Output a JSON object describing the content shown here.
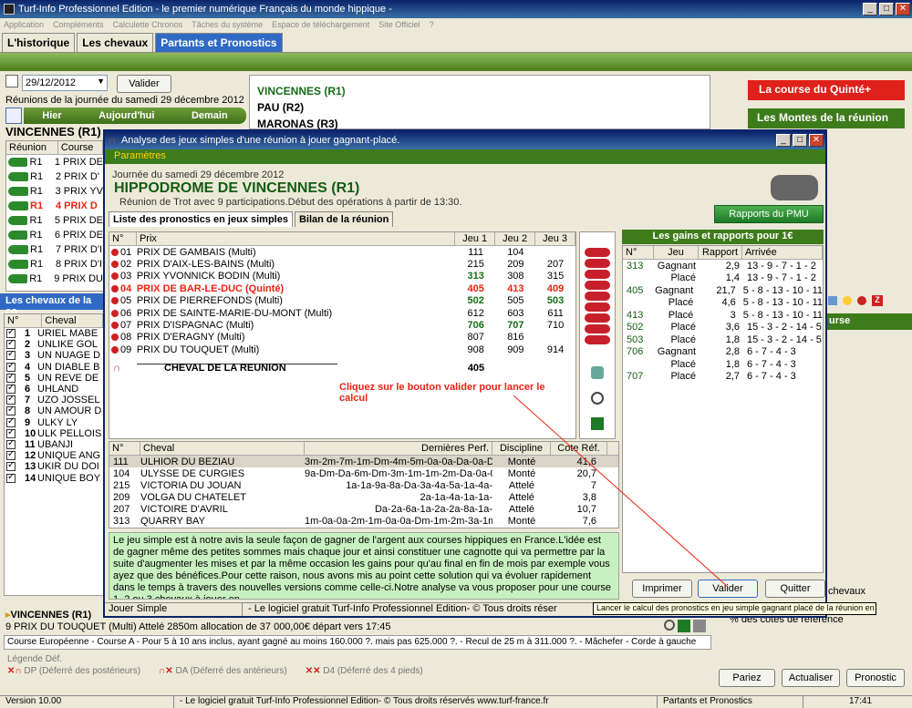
{
  "window": {
    "title": "Turf-Info Professionnel Edition - le premier numérique Français du monde hippique -"
  },
  "menu": [
    "Application",
    "Compléments",
    "Calculette Chronos",
    "Tâches du système",
    "Espace de téléchargement",
    "Site Officiel",
    "?"
  ],
  "tabs": [
    "L'historique",
    "Les chevaux",
    "Partants et Pronostics"
  ],
  "left": {
    "date": "29/12/2012",
    "validate": "Valider",
    "reunions_title": "Réunions de la journée du samedi 29 décembre 2012",
    "nav": [
      "Hier",
      "Aujourd'hui",
      "Demain"
    ],
    "header": "VINCENNES (R1)",
    "columns": [
      "Réunion",
      "Course"
    ],
    "races": [
      {
        "r": "R1",
        "c": "1 PRIX DE"
      },
      {
        "r": "R1",
        "c": "2 PRIX D'"
      },
      {
        "r": "R1",
        "c": "3 PRIX YV"
      },
      {
        "r": "R1",
        "c": "4 PRIX D"
      },
      {
        "r": "R1",
        "c": "5 PRIX DE"
      },
      {
        "r": "R1",
        "c": "6 PRIX DE"
      },
      {
        "r": "R1",
        "c": "7 PRIX D'I"
      },
      {
        "r": "R1",
        "c": "8 PRIX D'I"
      },
      {
        "r": "R1",
        "c": "9 PRIX DU"
      }
    ],
    "chevaux_title": "Les chevaux de la co",
    "chevaux_cols": [
      "N°",
      "Cheval"
    ],
    "chevaux": [
      {
        "n": "1",
        "name": "URIEL MABE"
      },
      {
        "n": "2",
        "name": "UNLIKE GOL"
      },
      {
        "n": "3",
        "name": "UN NUAGE D"
      },
      {
        "n": "4",
        "name": "UN DIABLE B"
      },
      {
        "n": "5",
        "name": "UN REVE DE"
      },
      {
        "n": "6",
        "name": "UHLAND"
      },
      {
        "n": "7",
        "name": "UZO JOSSEL"
      },
      {
        "n": "8",
        "name": "UN AMOUR D"
      },
      {
        "n": "9",
        "name": "ULKY LY"
      },
      {
        "n": "10",
        "name": "ULK PELLOIS"
      },
      {
        "n": "11",
        "name": "UBANJI"
      },
      {
        "n": "12",
        "name": "UNIQUE ANG"
      },
      {
        "n": "13",
        "name": "UKIR DU DOI"
      },
      {
        "n": "14",
        "name": "UNIQUE BOY"
      }
    ]
  },
  "center": {
    "lines": [
      "VINCENNES (R1)",
      "PAU (R2)",
      "MARONAS (R3)"
    ]
  },
  "right": {
    "quinte": "La course du Quinté+",
    "montes": "Les Montes de la réunion",
    "course_label": "urse",
    "filters": [
      "chevaux",
      "% des cotes de référence"
    ],
    "buttons": [
      "Pariez",
      "Actualiser",
      "Pronostic"
    ]
  },
  "bottom": {
    "race_title": "VINCENNES (R1)",
    "race_desc": "9 PRIX DU TOUQUET (Multi) Attelé 2850m allocation de 37 000,00€ départ vers 17:45",
    "conditions": "Course Européenne - Course A - Pour 5 à 10 ans inclus, ayant gagné au moins 160.000 ?. mais pas 625.000 ?. - Recul de 25 m à 311.000 ?. - Mâchefer - Corde à gauche",
    "legend_title": "Légende Déf.",
    "legend": [
      "DP (Déferré des postérieurs)",
      "DA (Déferré des antérieurs)",
      "D4 (Déferré des 4 pieds)"
    ],
    "status": [
      "Version 10.00",
      "- Le logiciel gratuit Turf-Info Professionnel Edition- © Tous droits réservés www.turf-france.fr",
      "Partants et Pronostics",
      "17:41"
    ]
  },
  "dialog": {
    "title": "Analyse des jeux simples d'une réunion à jouer gagnant-placé.",
    "params": "Paramètres",
    "journee": "Journée du samedi 29 décembre 2012",
    "hippodrome": "HIPPODROME DE  VINCENNES (R1)",
    "reunion_info": "Réunion de Trot avec 9 participations.Début des opérations à partir de 13:30.",
    "pmu_button": "Rapports du PMU",
    "subtabs": [
      "Liste des pronostics en jeux simples",
      "Bilan de la réunion"
    ],
    "cols": [
      "N°",
      "Prix",
      "Jeu 1",
      "Jeu 2",
      "Jeu 3"
    ],
    "races": [
      {
        "n": "01",
        "prix": "PRIX DE GAMBAIS (Multi)",
        "j1": "111",
        "j2": "104",
        "j3": ""
      },
      {
        "n": "02",
        "prix": "PRIX D'AIX-LES-BAINS (Multi)",
        "j1": "215",
        "j2": "209",
        "j3": "207"
      },
      {
        "n": "03",
        "prix": "PRIX YVONNICK BODIN (Multi)",
        "j1": "313",
        "j2": "308",
        "j3": "315"
      },
      {
        "n": "04",
        "prix": "PRIX DE BAR-LE-DUC (Quinté)",
        "j1": "405",
        "j2": "413",
        "j3": "409"
      },
      {
        "n": "05",
        "prix": "PRIX DE PIERREFONDS (Multi)",
        "j1": "502",
        "j2": "505",
        "j3": "503"
      },
      {
        "n": "06",
        "prix": "PRIX DE SAINTE-MARIE-DU-MONT (Multi)",
        "j1": "612",
        "j2": "603",
        "j3": "611"
      },
      {
        "n": "07",
        "prix": "PRIX D'ISPAGNAC (Multi)",
        "j1": "706",
        "j2": "707",
        "j3": "710"
      },
      {
        "n": "08",
        "prix": "PRIX D'ERAGNY (Multi)",
        "j1": "807",
        "j2": "816",
        "j3": ""
      },
      {
        "n": "09",
        "prix": "PRIX DU TOUQUET (Multi)",
        "j1": "908",
        "j2": "909",
        "j3": "914"
      }
    ],
    "cheval_reunion": "CHEVAL DE LA REUNION",
    "cheval_reunion_val": "405",
    "hint": "Cliquez sur le bouton valider pour lancer le calcul",
    "gains_title": "Les gains et rapports pour 1€",
    "gains_cols": [
      "N°",
      "Jeu",
      "Rapport",
      "Arrivée"
    ],
    "gains": [
      {
        "n": "313",
        "jeu": "Gagnant",
        "r": "2,9",
        "a": "13 - 9 - 7 - 1 - 2"
      },
      {
        "n": "",
        "jeu": "Placé",
        "r": "1,4",
        "a": "13 - 9 - 7 - 1 - 2"
      },
      {
        "n": "405",
        "jeu": "Gagnant",
        "r": "21,7",
        "a": "5 - 8 - 13 - 10 - 11"
      },
      {
        "n": "",
        "jeu": "Placé",
        "r": "4,6",
        "a": "5 - 8 - 13 - 10 - 11"
      },
      {
        "n": "413",
        "jeu": "Placé",
        "r": "3",
        "a": "5 - 8 - 13 - 10 - 11"
      },
      {
        "n": "502",
        "jeu": "Placé",
        "r": "3,6",
        "a": "15 - 3 - 2 - 14 - 5"
      },
      {
        "n": "503",
        "jeu": "Placé",
        "r": "1,8",
        "a": "15 - 3 - 2 - 14 - 5"
      },
      {
        "n": "706",
        "jeu": "Gagnant",
        "r": "2,8",
        "a": "6 - 7 - 4 - 3"
      },
      {
        "n": "",
        "jeu": "Placé",
        "r": "1,8",
        "a": "6 - 7 - 4 - 3"
      },
      {
        "n": "707",
        "jeu": "Placé",
        "r": "2,7",
        "a": "6 - 7 - 4 - 3"
      }
    ],
    "horse_cols": [
      "N°",
      "Cheval",
      "Dernières Perf.",
      "Discipline",
      "Cote Réf."
    ],
    "horses": [
      {
        "n": "111",
        "name": "ULHIOR DU BEZIAU",
        "perf": "3m-2m-7m-1m-Dm-4m-5m-0a-0a-Da-0a-Da-",
        "disc": "Monté",
        "cote": "41,6"
      },
      {
        "n": "104",
        "name": "ULYSSE DE CURGIES",
        "perf": "9a-Dm-Da-6m-Dm-3m-1m-1m-2m-Da-0a-0a-",
        "disc": "Monté",
        "cote": "20,7"
      },
      {
        "n": "215",
        "name": "VICTORIA DU JOUAN",
        "perf": "1a-1a-9a-8a-Da-3a-4a-5a-1a-4a-",
        "disc": "Attelé",
        "cote": "7"
      },
      {
        "n": "209",
        "name": "VOLGA DU CHATELET",
        "perf": "2a-1a-4a-1a-1a-",
        "disc": "Attelé",
        "cote": "3,8"
      },
      {
        "n": "207",
        "name": "VICTOIRE D'AVRIL",
        "perf": "Da-2a-6a-1a-2a-2a-8a-1a-",
        "disc": "Attelé",
        "cote": "10,7"
      },
      {
        "n": "313",
        "name": "QUARRY BAY",
        "perf": "1m-0a-0a-2m-1m-0a-0a-Dm-1m-2m-3a-1m-",
        "disc": "Monté",
        "cote": "7,6"
      }
    ],
    "description": "Le jeu simple est à notre avis la seule façon de gagner de l'argent aux courses hippiques en France.L'idée est de gagner même des petites sommes mais chaque jour et ainsi constituer une cagnotte qui va permettre par la suite d'augmenter les mises et par la même occasion les gains pour qu'au final en fin de mois par exemple vous ayez que des bénéfices.Pour cette raison, nous avons mis au point cette solution qui va évoluer rapidement dans le temps à travers des nouvelles versions comme celle-ci.Notre analyse va vous proposer pour une course 1, 2 ou 3 chevaux à jouer en",
    "buttons": [
      "Imprimer",
      "Valider",
      "Quitter"
    ],
    "status_left": "Jouer Simple",
    "status_mid": "- Le logiciel gratuit Turf-Info Professionnel Edition- © Tous droits réser",
    "tooltip": "Lancer le calcul des pronostics en jeu simple gagnant placé de la réunion en cours"
  }
}
